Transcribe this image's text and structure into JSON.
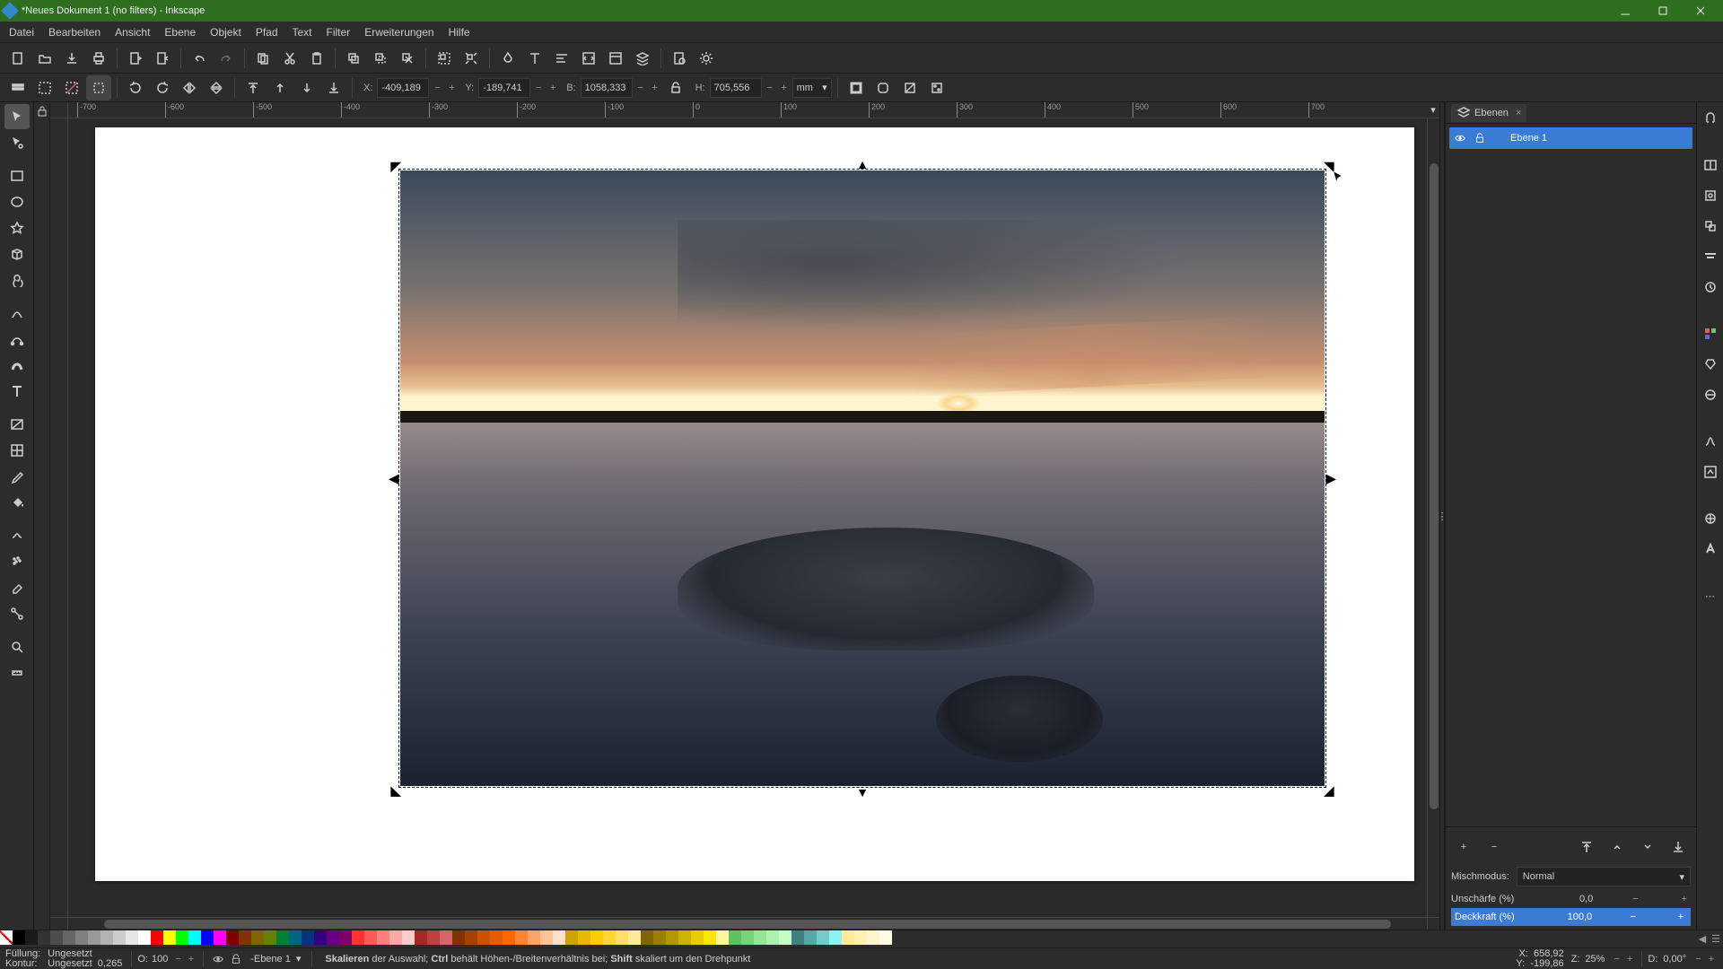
{
  "title": "*Neues Dokument 1 (no filters) - Inkscape",
  "menus": [
    "Datei",
    "Bearbeiten",
    "Ansicht",
    "Ebene",
    "Objekt",
    "Pfad",
    "Text",
    "Filter",
    "Erweiterungen",
    "Hilfe"
  ],
  "coords": {
    "x_label": "X:",
    "x": "-409,189",
    "y_label": "Y:",
    "y": "-189,741",
    "w_label": "B:",
    "w": "1058,333",
    "h_label": "H:",
    "h": "705,556",
    "unit": "mm"
  },
  "ruler_ticks": [
    "-700",
    "-600",
    "-500",
    "-400",
    "-300",
    "-200",
    "-100",
    "0",
    "100",
    "200",
    "300",
    "400",
    "500",
    "600",
    "700"
  ],
  "dock": {
    "tab": "Ebenen",
    "layer_name": "Ebene 1",
    "blend_label": "Mischmodus:",
    "blend_value": "Normal",
    "blur_label": "Unschärfe (%)",
    "blur_value": "0,0",
    "opacity_label": "Deckkraft (%)",
    "opacity_value": "100,0"
  },
  "palette_hex": [
    "#000000",
    "#1a1a1a",
    "#333333",
    "#4d4d4d",
    "#666666",
    "#808080",
    "#999999",
    "#b3b3b3",
    "#cccccc",
    "#e6e6e6",
    "#ffffff",
    "#ff0000",
    "#ffff00",
    "#00ff00",
    "#00ffff",
    "#0000ff",
    "#ff00ff",
    "#800000",
    "#803300",
    "#806600",
    "#668000",
    "#008033",
    "#006680",
    "#003380",
    "#330080",
    "#660080",
    "#800066",
    "#ff3333",
    "#ff5959",
    "#ff8080",
    "#ffa6a6",
    "#ffcccc",
    "#a62929",
    "#bf4040",
    "#d96666",
    "#803300",
    "#a64200",
    "#cc5200",
    "#e65c00",
    "#ff6600",
    "#ff8533",
    "#ffa366",
    "#ffc299",
    "#ffe0cc",
    "#cca300",
    "#e6b800",
    "#ffcc00",
    "#ffd633",
    "#ffe066",
    "#ffeb99",
    "#806600",
    "#998000",
    "#b39900",
    "#ccb300",
    "#e6cc00",
    "#ffe600",
    "#fff599",
    "#60bf60",
    "#79d279",
    "#93e693",
    "#acf2ac",
    "#c6ffc6",
    "#408080",
    "#59a6a6",
    "#73cccc",
    "#8cf2f2",
    "#ffeb99",
    "#fff0b3",
    "#fff5cc",
    "#fffae6"
  ],
  "status": {
    "fill_label": "Füllung:",
    "fill_value": "Ungesetzt",
    "stroke_label": "Kontur:",
    "stroke_value": "Ungesetzt",
    "stroke_width": "0,265",
    "opacity_label": "O:",
    "opacity_value": "100",
    "layer_indicator": "-Ebene 1",
    "hint_bold1": "Skalieren",
    "hint_plain1": " der Auswahl; ",
    "hint_bold2": "Ctrl",
    "hint_plain2": " behält Höhen-/Breitenverhältnis bei; ",
    "hint_bold3": "Shift",
    "hint_plain3": " skaliert um den Drehpunkt",
    "x_label": "X:",
    "x": "658,92",
    "y_label": "Y:",
    "y": "-199,86",
    "z_label": "Z:",
    "z": "25%",
    "d_label": "D:",
    "d": "0,00°"
  }
}
